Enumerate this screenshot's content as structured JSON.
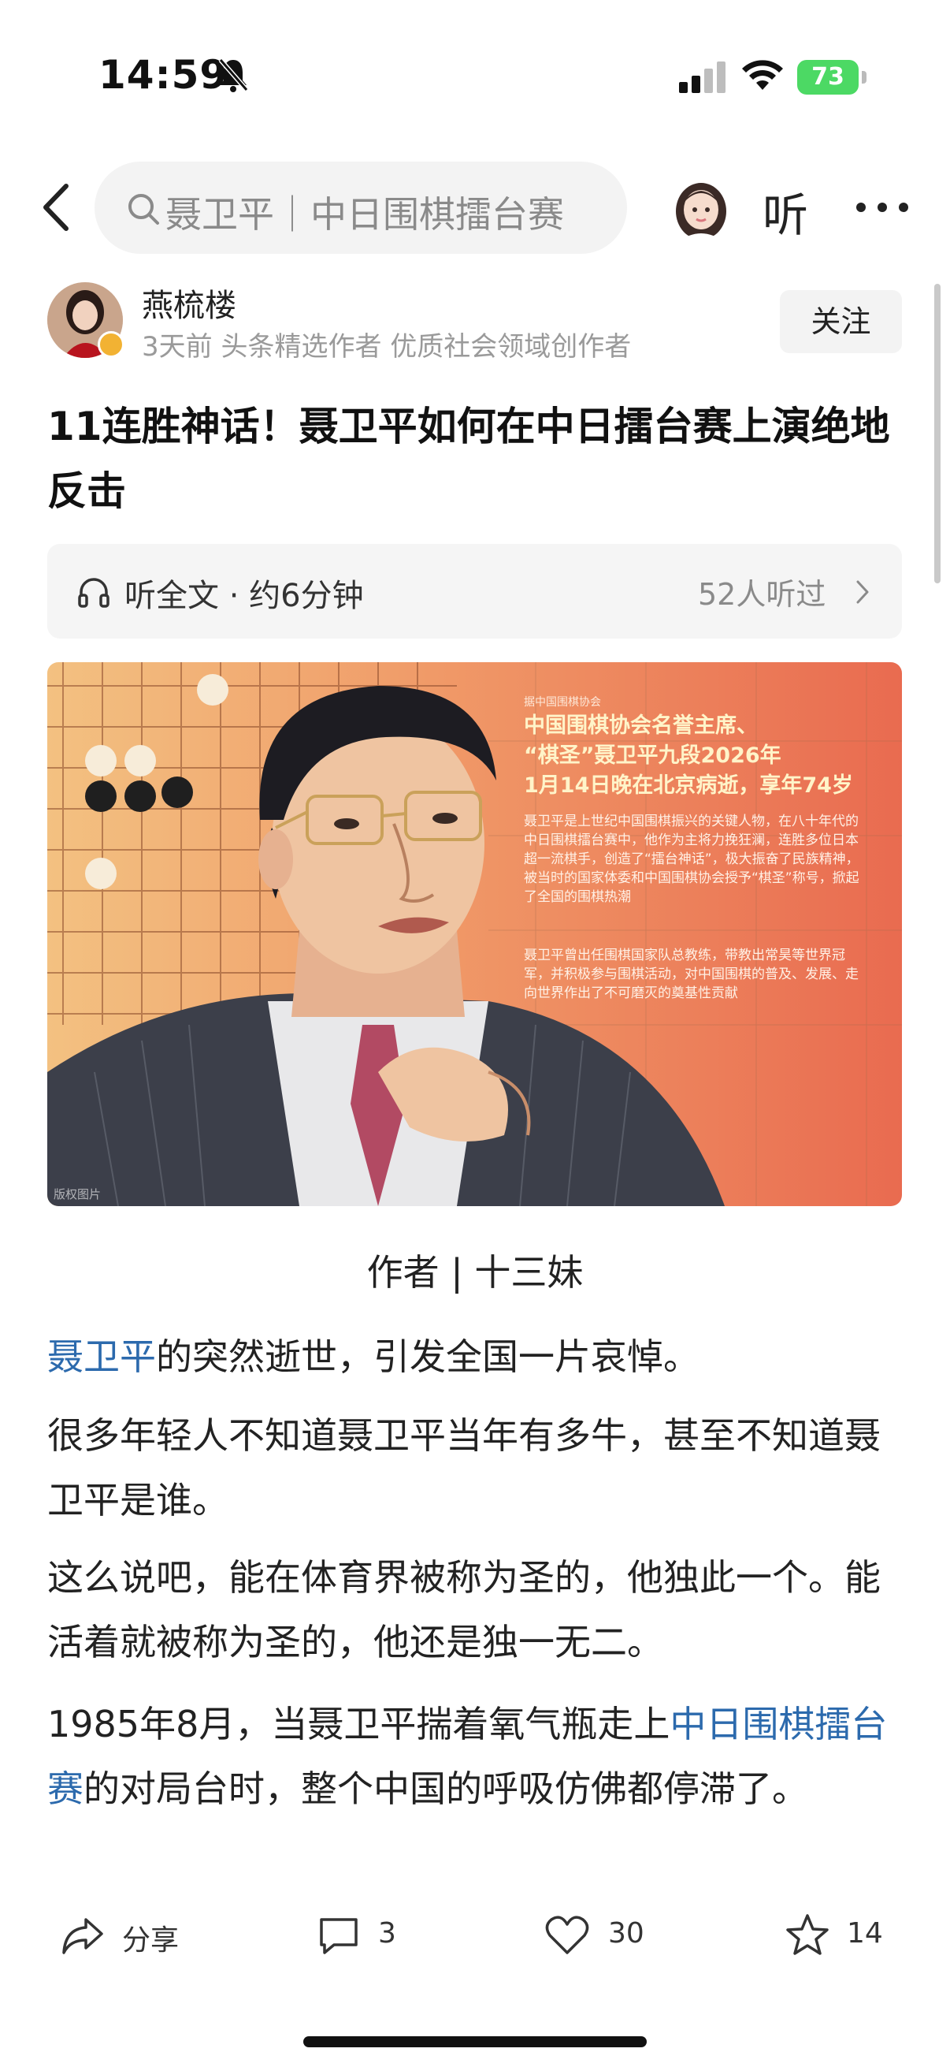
{
  "status_bar": {
    "time": "14:59",
    "battery": "73",
    "icons": [
      "bell-slash-icon",
      "cellular-signal-icon",
      "wifi-icon",
      "battery-icon"
    ],
    "battery_color": "#4cd964"
  },
  "nav": {
    "search_text": "聂卫平｜中日围棋擂台赛",
    "listen_label": "听",
    "icons": [
      "back-icon",
      "search-icon",
      "avatar-icon",
      "more-icon"
    ]
  },
  "author": {
    "name": "燕梳楼",
    "meta": "3天前  头条精选作者 优质社会领域创作者",
    "follow_label": "关注"
  },
  "article": {
    "title": "11连胜神话！聂卫平如何在中日擂台赛上演绝地反击",
    "listen_bar": {
      "label": "听全文 · 约6分钟",
      "count": "52人听过"
    },
    "hero_image": {
      "org": "据中国围棋协会",
      "heading_lines": [
        "中国围棋协会名誉主席、",
        "“棋圣”聂卫平九段2026年",
        "1月14日晚在北京病逝，享年74岁"
      ],
      "para1": "聂卫平是上世纪中国围棋振兴的关键人物，在八十年代的中日围棋擂台赛中，他作为主将力挽狂澜，连胜多位日本超一流棋手，创造了“擂台神话”，极大振奋了民族精神，被当时的国家体委和中国围棋协会授予“棋圣”称号，掀起了全国的围棋热潮",
      "para2": "聂卫平曾出任围棋国家队总教练，带教出常昊等世界冠军，并积极参与围棋活动，对中国围棋的普及、发展、走向世界作出了不可磨灭的奠基性贡献",
      "watermark": "版权图片"
    },
    "byline": "作者 | 十三妹",
    "p1_link": "聂卫平",
    "p1_rest": "的突然逝世，引发全国一片哀悼。",
    "p2": "很多年轻人不知道聂卫平当年有多牛，甚至不知道聂卫平是谁。",
    "p3": "这么说吧，能在体育界被称为圣的，他独此一个。能活着就被称为圣的，他还是独一无二。",
    "p4_pre": "1985年8月，当聂卫平揣着氧气瓶走上",
    "p4_link": "中日围棋擂台赛",
    "p4_post": "的对局台时，整个中国的呼吸仿佛都停滞了。",
    "link_color": "#2c6aad"
  },
  "actions": {
    "share": "分享",
    "comments": "3",
    "likes": "30",
    "favorites": "14"
  }
}
